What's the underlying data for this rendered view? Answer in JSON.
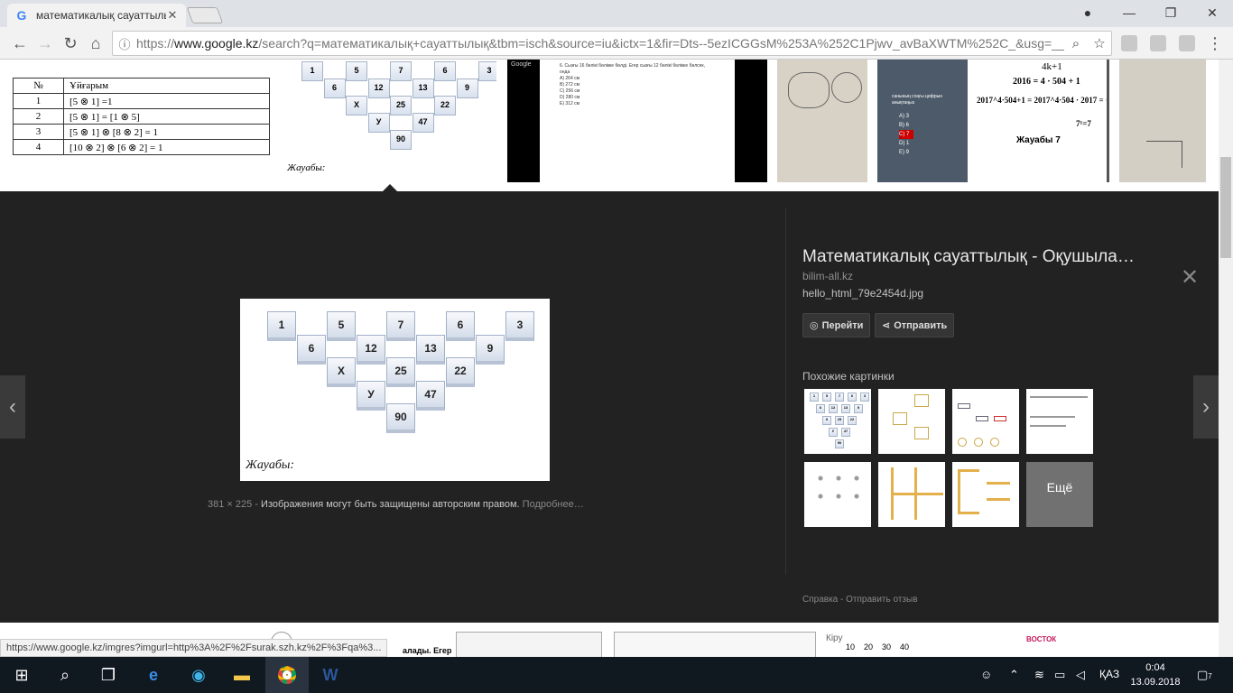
{
  "browser": {
    "tab_title": "математикалық сауаттылы",
    "url_prefix": "https://",
    "url_host": "www.google.kz",
    "url_rest": "/search?q=математикалық+сауаттылық&tbm=isch&source=iu&ictx=1&fir=Dts--5ezICGGsM%253A%252C1Pjwv_avBaXWTM%252C_&usg=__",
    "status_url": "https://www.google.kz/imgres?imgurl=http%3A%2F%2Fsurak.szh.kz%2F%3Fqa%3..."
  },
  "thumbs": {
    "table_header": [
      "№",
      "Ұйғарым"
    ],
    "table_rows": [
      [
        "1",
        "[5 ⊗ 1] =1"
      ],
      [
        "2",
        "[5 ⊗ 1] = [1 ⊗ 5]"
      ],
      [
        "3",
        "[5 ⊗ 1] ⊗ [8 ⊗ 2] = 1"
      ],
      [
        "4",
        "[10 ⊗ 2] ⊗ [6 ⊗ 2] = 1"
      ]
    ],
    "pyramid_small_label": "Жауабы:",
    "t3_google": "Google",
    "t3_line1": "6. Сызғы 16 бөлікі бөлікке бөлді. Егер сызғы 12 бөлікі бөлікке бөлсек, онда",
    "t3_options": [
      "A) 264 см",
      "B) 272 см",
      "C) 256 см",
      "D) 280 см",
      "E) 312 см"
    ],
    "t5_question": "санының соңғы цифрын анықтаңыз",
    "t5_options": [
      "A) 3",
      "B) 6",
      "C) 7",
      "D) 1",
      "E) 9"
    ],
    "t6_line1": "4k+1",
    "t6_line2": "2016 = 4 · 504 + 1",
    "t6_line3": "2017^4·504+1 = 2017^4·504 · 2017 = ···7",
    "t6_line4": "7¹=7",
    "t6_answer": "Жауабы 7"
  },
  "viewer": {
    "pyramid": [
      "1",
      "5",
      "7",
      "6",
      "3",
      "6",
      "12",
      "13",
      "9",
      "X",
      "25",
      "22",
      "У",
      "47",
      "90"
    ],
    "answer_label": "Жауабы:",
    "dimensions": "381 × 225",
    "copyright": "Изображения могут быть защищены авторским правом.",
    "more_link": "Подробнее…",
    "title": "Математикалық сауаттылық - Оқушыла…",
    "site": "bilim-all.kz",
    "filename": "hello_html_79e2454d.jpg",
    "goto_button": "Перейти",
    "share_button": "Отправить",
    "similar_label": "Похожие картинки",
    "more_label": "Ещё",
    "footer_help": "Справка",
    "footer_sep": "-",
    "footer_feedback": "Отправить отзыв"
  },
  "bottom_strip": {
    "text1": "алады. Егер",
    "kiru": "Кіру",
    "numbers": [
      "10",
      "20",
      "30",
      "40"
    ],
    "vostok": "ВОСТОК"
  },
  "taskbar": {
    "lang": "ҚАЗ",
    "time": "0:04",
    "date": "13.09.2018",
    "notif_count": "7"
  }
}
